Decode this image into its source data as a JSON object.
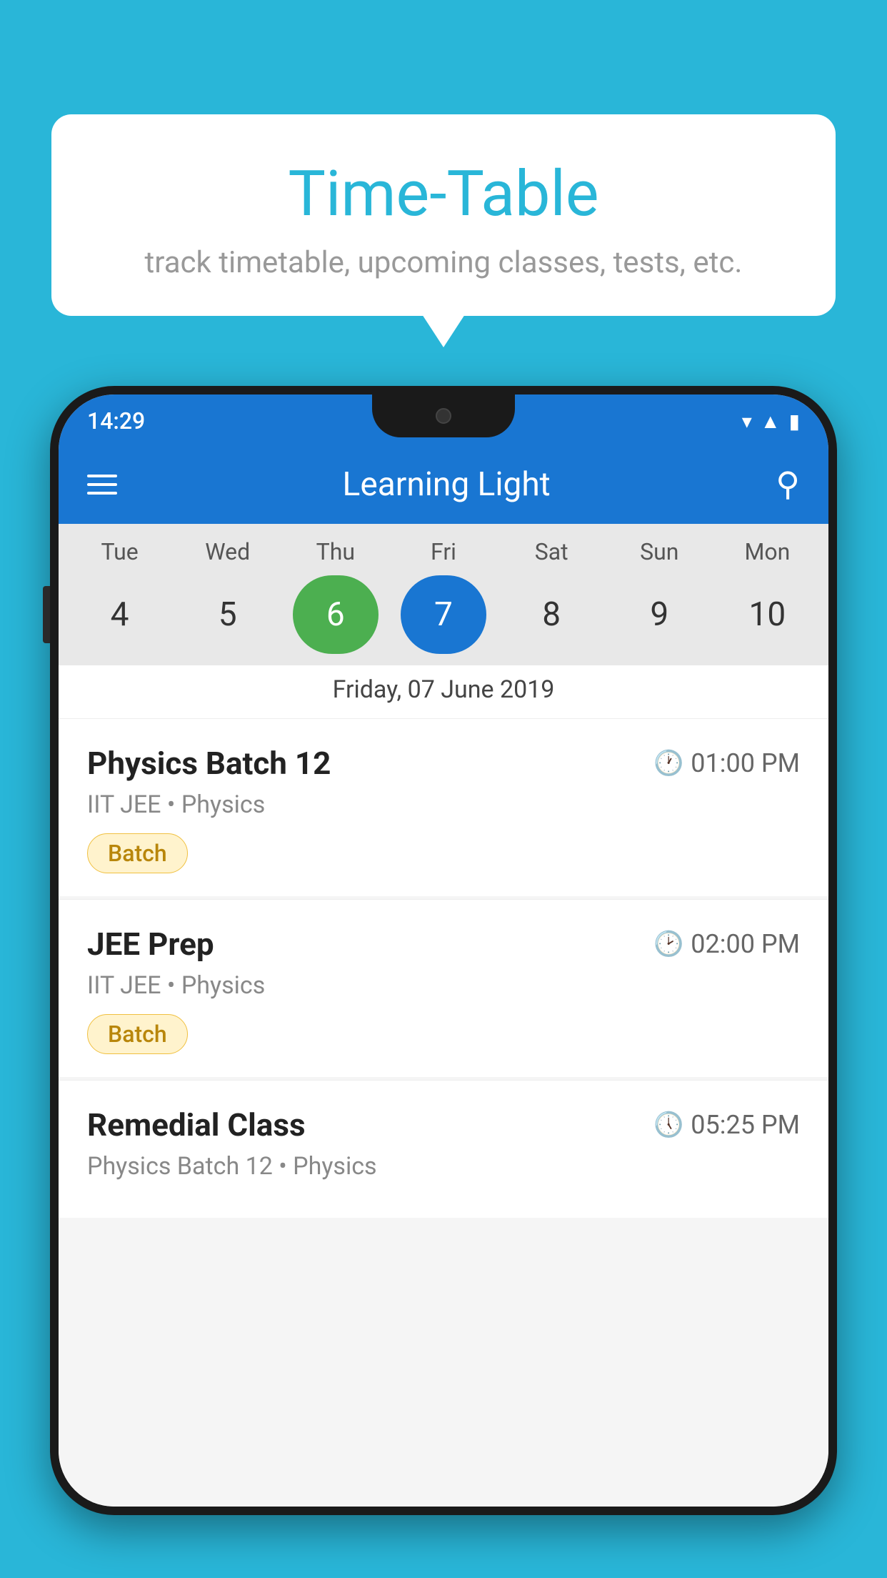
{
  "background_color": "#29B6D8",
  "bubble": {
    "title": "Time-Table",
    "subtitle": "track timetable, upcoming classes, tests, etc."
  },
  "status_bar": {
    "time": "14:29"
  },
  "app_bar": {
    "title": "Learning Light"
  },
  "calendar": {
    "days": [
      "Tue",
      "Wed",
      "Thu",
      "Fri",
      "Sat",
      "Sun",
      "Mon"
    ],
    "dates": [
      4,
      5,
      6,
      7,
      8,
      9,
      10
    ],
    "today_index": 2,
    "selected_index": 3,
    "selected_date_label": "Friday, 07 June 2019"
  },
  "schedule": [
    {
      "name": "Physics Batch 12",
      "time": "01:00 PM",
      "detail": "IIT JEE • Physics",
      "badge": "Batch"
    },
    {
      "name": "JEE Prep",
      "time": "02:00 PM",
      "detail": "IIT JEE • Physics",
      "badge": "Batch"
    },
    {
      "name": "Remedial Class",
      "time": "05:25 PM",
      "detail": "Physics Batch 12 • Physics",
      "badge": null
    }
  ]
}
